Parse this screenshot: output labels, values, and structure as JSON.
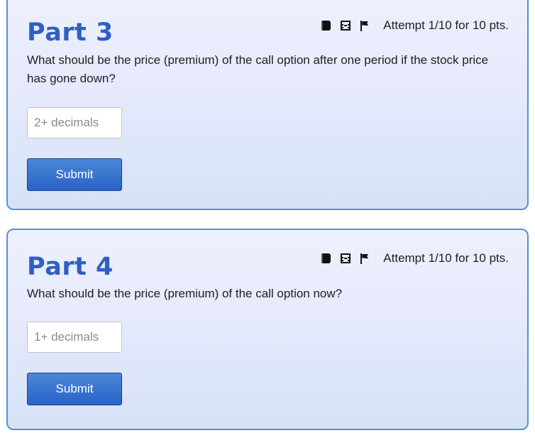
{
  "parts": [
    {
      "title": "Part 3",
      "icons": [
        "book-icon",
        "film-icon",
        "flag-icon"
      ],
      "attempt": "Attempt 1/10 for 10 pts.",
      "question": "What should be the price (premium) of the call option after one period if the stock price has gone down?",
      "input_placeholder": "2+ decimals",
      "input_value": "",
      "submit_label": "Submit"
    },
    {
      "title": "Part 4",
      "icons": [
        "book-icon",
        "film-icon",
        "flag-icon"
      ],
      "attempt": "Attempt 1/10 for 10 pts.",
      "question": "What should be the price (premium) of the call option now?",
      "input_placeholder": "1+ decimals",
      "input_value": "",
      "submit_label": "Submit"
    }
  ],
  "colors": {
    "title": "#2f5fc4",
    "card_border": "#5b8fd0",
    "button": "#2a63c6"
  }
}
